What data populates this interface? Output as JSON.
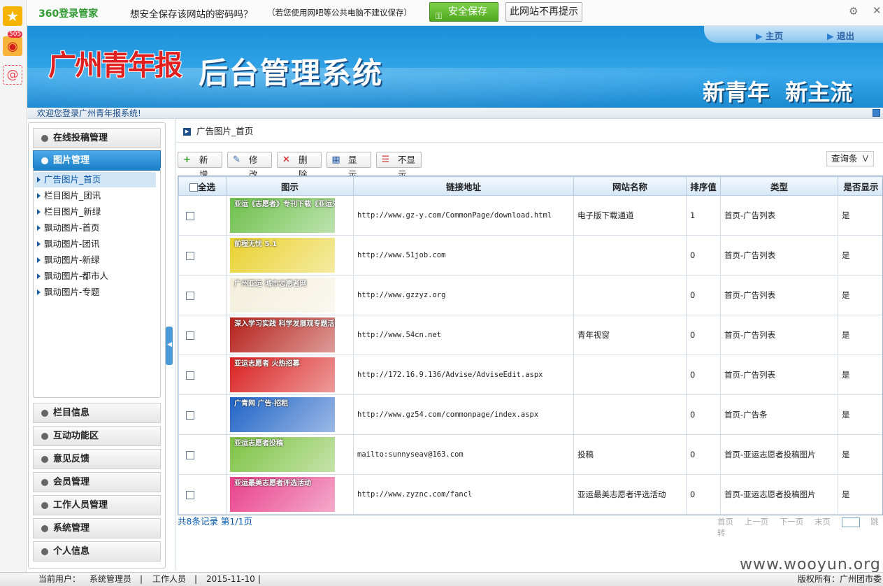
{
  "password_bar": {
    "brand": "360登录管家",
    "prompt": "想安全保存该网站的密码吗？",
    "hint": "（若您使用网吧等公共电脑不建议保存）",
    "save_button": "安全保存",
    "never_button": "此网站不再提示",
    "settings_icon": "gear-icon",
    "close_icon": "close-icon"
  },
  "left_strip": {
    "weibo_badge": "505"
  },
  "header": {
    "logo": "广州青年报",
    "system_title": "后台管理系统",
    "slogan": "新青年  新主流",
    "home_link": "主页",
    "logout_link": "退出"
  },
  "welcome": "欢迎您登录广州青年报系统!",
  "menu": {
    "sections_top": [
      {
        "label": "在线投稿管理",
        "active": false
      },
      {
        "label": "图片管理",
        "active": true
      }
    ],
    "sub_items": [
      "广告图片_首页",
      "栏目图片_团讯",
      "栏目图片_新绿",
      "飘动图片-首页",
      "飘动图片-团讯",
      "飘动图片-新绿",
      "飘动图片-都市人",
      "飘动图片-专题"
    ],
    "selected_sub": 0,
    "sections_bottom": [
      "栏目信息",
      "互动功能区",
      "意见反馈",
      "会员管理",
      "工作人员管理",
      "系统管理",
      "个人信息"
    ]
  },
  "breadcrumb": "广告图片_首页",
  "toolbar": {
    "add": "新增",
    "edit": "修改",
    "delete": "删除",
    "show": "显示",
    "hide": "不显示",
    "query": "查询条"
  },
  "table": {
    "headers": [
      "全选",
      "图示",
      "链接地址",
      "网站名称",
      "排序值",
      "类型",
      "是否显示"
    ],
    "rows": [
      {
        "thumb": "亚运《志愿者》专刊下载《亚运先锋》专版下载",
        "thumb_color": "#6cc04a",
        "url": "http://www.gz-y.com/CommonPage/download.html",
        "site": "电子版下载通道",
        "order": "1",
        "type": "首页-广告列表",
        "show": "是"
      },
      {
        "thumb": "前程无忧 5.1",
        "thumb_color": "#e9d22e",
        "url": "http://www.51job.com",
        "site": "",
        "order": "0",
        "type": "首页-广告列表",
        "show": "是"
      },
      {
        "thumb": "广州亚运 城市志愿者网",
        "thumb_color": "#f3eedb",
        "url": "http://www.gzzyz.org",
        "site": "",
        "order": "0",
        "type": "首页-广告列表",
        "show": "是"
      },
      {
        "thumb": "深入学习实践 科学发展观专题活动",
        "thumb_color": "#b5201a",
        "url": "http://www.54cn.net",
        "site": "青年视窗",
        "order": "0",
        "type": "首页-广告列表",
        "show": "是"
      },
      {
        "thumb": "亚运志愿者 火热招募",
        "thumb_color": "#d92020",
        "url": "http://172.16.9.136/Advise/AdviseEdit.aspx",
        "site": "",
        "order": "0",
        "type": "首页-广告列表",
        "show": "是"
      },
      {
        "thumb": "广青网  广告·招租",
        "thumb_color": "#1f63c6",
        "url": "http://www.gz54.com/commonpage/index.aspx",
        "site": "",
        "order": "0",
        "type": "首页-广告条",
        "show": "是"
      },
      {
        "thumb": "亚运志愿者投稿",
        "thumb_color": "#7dc242",
        "url": "mailto:sunnyseav@163.com",
        "site": "投稿",
        "order": "0",
        "type": "首页-亚运志愿者投稿图片",
        "show": "是"
      },
      {
        "thumb": "亚运最美志愿者评选活动",
        "thumb_color": "#e8408a",
        "url": "http://www.zyznc.com/fancl",
        "site": "亚运最美志愿者评选活动",
        "order": "0",
        "type": "首页-亚运志愿者投稿图片",
        "show": "是"
      }
    ]
  },
  "pagination": {
    "info": "共8条记录 第1/1页",
    "first": "首页",
    "prev": "上一页",
    "next": "下一页",
    "last": "末页",
    "jump": "跳转"
  },
  "status_bar": {
    "current_user_label": "当前用户：",
    "user": "系统管理员",
    "role": "工作人员",
    "date": "2015-11-10",
    "copyright": "版权所有：广州团市委"
  },
  "watermark": "www.wooyun.org",
  "colors": {
    "header_blue": "#1a8fd8",
    "menu_active": "#1b7fc7",
    "save_green": "#5bb92a"
  }
}
